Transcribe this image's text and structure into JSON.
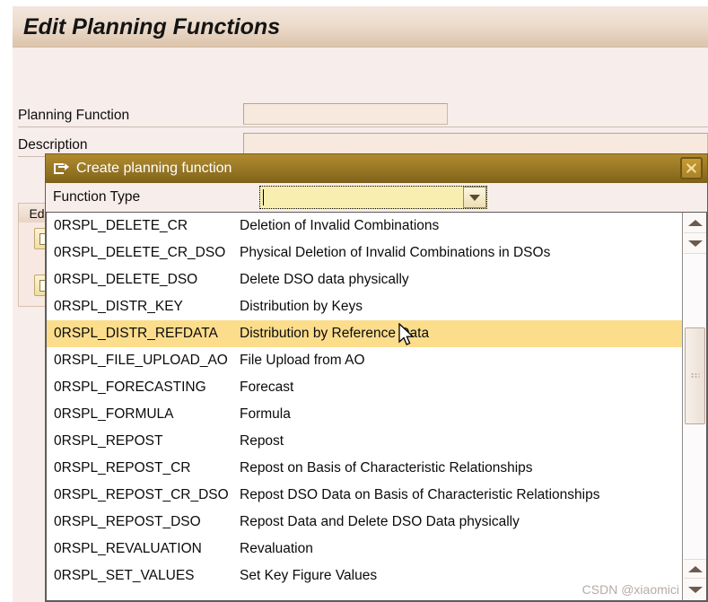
{
  "app": {
    "title": "Edit Planning Functions",
    "left_strip_color": "#ffffff",
    "titlebar_gradient_from": "#f3e6dc",
    "titlebar_gradient_to": "#d4b9a0"
  },
  "form": {
    "rows": [
      {
        "label": "Planning Function",
        "value": "",
        "placeholder": ""
      },
      {
        "label": "Description",
        "value": "",
        "placeholder": ""
      }
    ]
  },
  "background_panel": {
    "tab_label": "Ed",
    "buttons": [
      {
        "name": "panel-button-1"
      },
      {
        "name": "panel-button-2"
      }
    ]
  },
  "dialog": {
    "title": "Create planning function",
    "title_icon": "create-document-icon",
    "close_icon": "close-icon",
    "accent_color": "#8d6e20",
    "field": {
      "label": "Function Type",
      "value": "",
      "placeholder": "",
      "dropdown_icon": "chevron-down-icon",
      "background": "#f8eeb0"
    },
    "dropdown": {
      "selected_index": 4,
      "highlight_color": "#fcdd8c",
      "items": [
        {
          "code": "0RSPL_DELETE_CR",
          "description": "Deletion of Invalid Combinations"
        },
        {
          "code": "0RSPL_DELETE_CR_DSO",
          "description": "Physical Deletion of Invalid Combinations in DSOs"
        },
        {
          "code": "0RSPL_DELETE_DSO",
          "description": "Delete DSO data physically"
        },
        {
          "code": "0RSPL_DISTR_KEY",
          "description": "Distribution by Keys"
        },
        {
          "code": "0RSPL_DISTR_REFDATA",
          "description": "Distribution by Reference Data"
        },
        {
          "code": "0RSPL_FILE_UPLOAD_AO",
          "description": "File Upload from AO"
        },
        {
          "code": "0RSPL_FORECASTING",
          "description": "Forecast"
        },
        {
          "code": "0RSPL_FORMULA",
          "description": "Formula"
        },
        {
          "code": "0RSPL_REPOST",
          "description": "Repost"
        },
        {
          "code": "0RSPL_REPOST_CR",
          "description": "Repost on Basis of Characteristic Relationships"
        },
        {
          "code": "0RSPL_REPOST_CR_DSO",
          "description": "Repost DSO Data on Basis of Characteristic Relationships"
        },
        {
          "code": "0RSPL_REPOST_DSO",
          "description": "Repost Data and Delete DSO Data physically"
        },
        {
          "code": "0RSPL_REVALUATION",
          "description": "Revaluation"
        },
        {
          "code": "0RSPL_SET_VALUES",
          "description": "Set Key Figure Values"
        }
      ],
      "scrollbar": {
        "up_icon": "scroll-up-icon",
        "down_icon": "scroll-down-icon"
      }
    }
  },
  "watermark": "CSDN @xiaomici"
}
